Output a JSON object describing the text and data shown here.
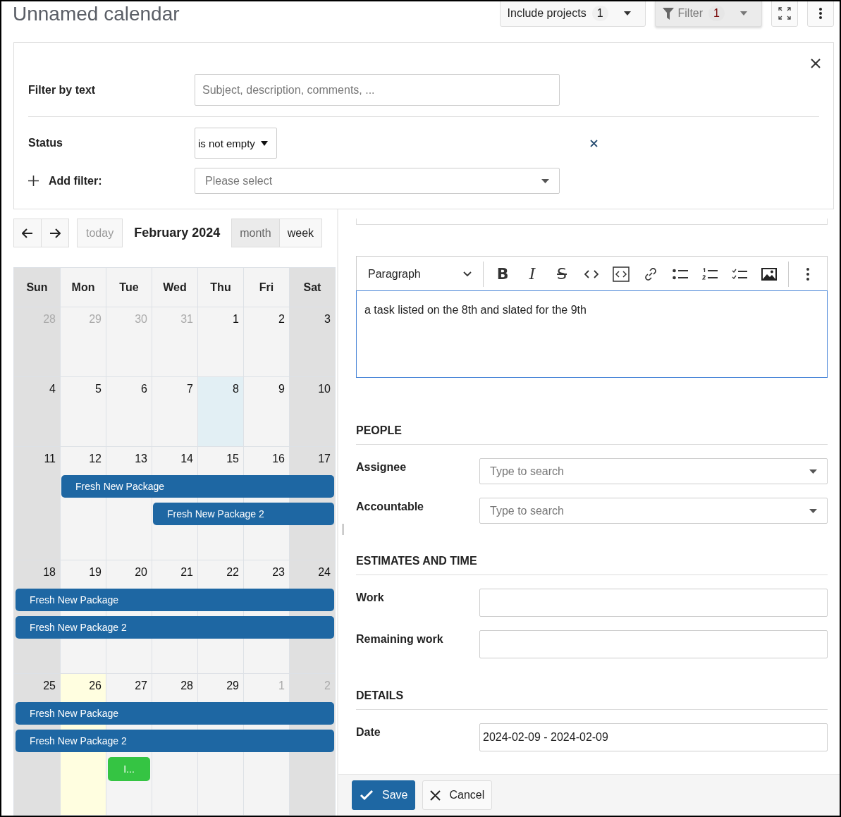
{
  "title": "Unnamed calendar",
  "toolbar": {
    "include_projects": {
      "label": "Include projects",
      "count": "1"
    },
    "filter": {
      "label": "Filter",
      "count": "1",
      "pressed": true
    }
  },
  "filter_panel": {
    "text_filter": {
      "label": "Filter by text",
      "placeholder": "Subject, description, comments, ..."
    },
    "filters": [
      {
        "label": "Status",
        "operator": "is not empty"
      }
    ],
    "add_filter": {
      "label": "Add filter:",
      "placeholder": "Please select"
    }
  },
  "calendar": {
    "today": {
      "label": "today",
      "disabled": true
    },
    "title": "February 2024",
    "views": [
      {
        "label": "month",
        "selected": true
      },
      {
        "label": "week",
        "selected": false
      }
    ],
    "weekdays": [
      {
        "label": "Sun",
        "weekend": true
      },
      {
        "label": "Mon",
        "weekend": false
      },
      {
        "label": "Tue",
        "weekend": false
      },
      {
        "label": "Wed",
        "weekend": false
      },
      {
        "label": "Thu",
        "weekend": false
      },
      {
        "label": "Fri",
        "weekend": false
      },
      {
        "label": "Sat",
        "weekend": true
      }
    ],
    "weeks": [
      {
        "days": [
          {
            "label": "28",
            "other_month": true,
            "today": false,
            "selected": false
          },
          {
            "label": "29",
            "other_month": true,
            "today": false,
            "selected": false
          },
          {
            "label": "30",
            "other_month": true,
            "today": false,
            "selected": false
          },
          {
            "label": "31",
            "other_month": true,
            "today": false,
            "selected": false
          },
          {
            "label": "1",
            "other_month": false,
            "today": false,
            "selected": false
          },
          {
            "label": "2",
            "other_month": false,
            "today": false,
            "selected": false
          },
          {
            "label": "3",
            "other_month": false,
            "today": false,
            "selected": false
          }
        ]
      },
      {
        "days": [
          {
            "label": "4",
            "other_month": false,
            "today": false,
            "selected": false
          },
          {
            "label": "5",
            "other_month": false,
            "today": false,
            "selected": false
          },
          {
            "label": "6",
            "other_month": false,
            "today": false,
            "selected": false
          },
          {
            "label": "7",
            "other_month": false,
            "today": false,
            "selected": false
          },
          {
            "label": "8",
            "other_month": false,
            "today": false,
            "selected": true
          },
          {
            "label": "9",
            "other_month": false,
            "today": false,
            "selected": false
          },
          {
            "label": "10",
            "other_month": false,
            "today": false,
            "selected": false
          }
        ]
      },
      {
        "days": [
          {
            "label": "11",
            "other_month": false,
            "today": false,
            "selected": false
          },
          {
            "label": "12",
            "other_month": false,
            "today": false,
            "selected": false,
            "events": [
              {
                "title": "Fresh New Package",
                "color": "#1e67a3",
                "to_week_end": true
              }
            ]
          },
          {
            "label": "13",
            "other_month": false,
            "today": false,
            "selected": false
          },
          {
            "label": "14",
            "other_month": false,
            "today": false,
            "selected": false,
            "events": [
              {
                "title": "Fresh New Package 2",
                "color": "#1e67a3",
                "to_week_end": true
              }
            ]
          },
          {
            "label": "15",
            "other_month": false,
            "today": false,
            "selected": false
          },
          {
            "label": "16",
            "other_month": false,
            "today": false,
            "selected": false
          },
          {
            "label": "17",
            "other_month": false,
            "today": false,
            "selected": false
          }
        ]
      },
      {
        "days": [
          {
            "label": "18",
            "other_month": false,
            "today": false,
            "selected": false,
            "events": [
              {
                "title": "Fresh New Package",
                "color": "#1e67a3",
                "to_week_end": true
              },
              {
                "title": "Fresh New Package 2",
                "color": "#1e67a3",
                "to_week_end": true
              }
            ]
          },
          {
            "label": "19",
            "other_month": false,
            "today": false,
            "selected": false
          },
          {
            "label": "20",
            "other_month": false,
            "today": false,
            "selected": false
          },
          {
            "label": "21",
            "other_month": false,
            "today": false,
            "selected": false
          },
          {
            "label": "22",
            "other_month": false,
            "today": false,
            "selected": false
          },
          {
            "label": "23",
            "other_month": false,
            "today": false,
            "selected": false
          },
          {
            "label": "24",
            "other_month": false,
            "today": false,
            "selected": false
          }
        ]
      },
      {
        "days": [
          {
            "label": "25",
            "other_month": false,
            "today": false,
            "selected": false,
            "events": [
              {
                "title": "Fresh New Package",
                "color": "#1e67a3",
                "to_week_end": true
              },
              {
                "title": "Fresh New Package 2",
                "color": "#1e67a3",
                "to_week_end": true
              }
            ]
          },
          {
            "label": "26",
            "other_month": false,
            "today": true,
            "selected": false
          },
          {
            "label": "27",
            "other_month": false,
            "today": false,
            "selected": false,
            "events": [
              {
                "title": "I...",
                "color": "#35c443",
                "to_week_end": false
              }
            ]
          },
          {
            "label": "28",
            "other_month": false,
            "today": false,
            "selected": false
          },
          {
            "label": "29",
            "other_month": false,
            "today": false,
            "selected": false
          },
          {
            "label": "1",
            "other_month": true,
            "today": false,
            "selected": false
          },
          {
            "label": "2",
            "other_month": true,
            "today": false,
            "selected": false
          }
        ]
      }
    ]
  },
  "editor": {
    "block_style": "Paragraph",
    "tools": [
      {
        "kind": "bold",
        "glyph": "B"
      },
      {
        "kind": "italic",
        "glyph": "I"
      },
      {
        "kind": "strike",
        "glyph": "S"
      },
      {
        "kind": "code"
      },
      {
        "kind": "code-block"
      },
      {
        "kind": "link"
      },
      {
        "kind": "bullets"
      },
      {
        "kind": "numbers"
      },
      {
        "kind": "todo"
      },
      {
        "kind": "image"
      }
    ],
    "content": "a task listed on the 8th and slated for the 9th"
  },
  "sections": [
    {
      "title": "PEOPLE",
      "fields": [
        {
          "label": "Assignee",
          "kind": "select",
          "placeholder": "Type to search"
        },
        {
          "label": "Accountable",
          "kind": "select",
          "placeholder": "Type to search"
        }
      ]
    },
    {
      "title": "ESTIMATES AND TIME",
      "fields": [
        {
          "label": "Work",
          "kind": "text"
        },
        {
          "label": "Remaining work",
          "kind": "text"
        }
      ]
    },
    {
      "title": "DETAILS",
      "fields": [
        {
          "label": "Date",
          "kind": "text",
          "value": "2024-02-09 - 2024-02-09"
        }
      ]
    }
  ],
  "actions": [
    {
      "label": "Save",
      "kind": "primary"
    },
    {
      "label": "Cancel",
      "kind": "secondary"
    }
  ]
}
